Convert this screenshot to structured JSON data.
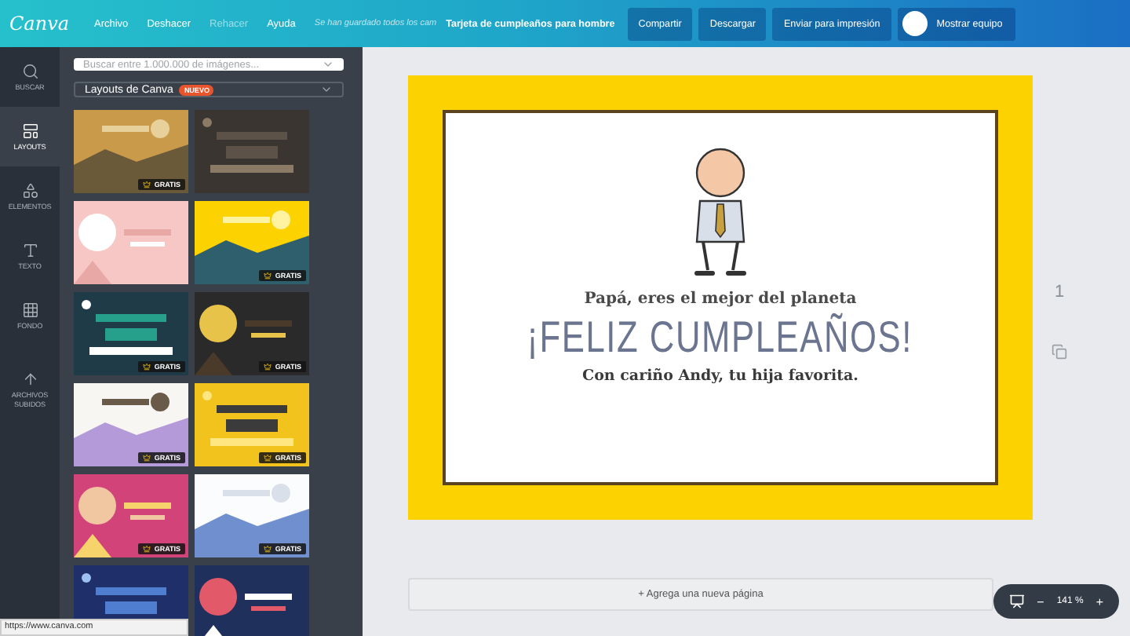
{
  "topbar": {
    "logo": "Canva",
    "menu": [
      {
        "label": "Archivo",
        "disabled": false
      },
      {
        "label": "Deshacer",
        "disabled": false
      },
      {
        "label": "Rehacer",
        "disabled": true
      },
      {
        "label": "Ayuda",
        "disabled": false
      }
    ],
    "save_status": "Se han guardado todos los cam",
    "title": "Tarjeta de cumpleaños para hombre",
    "buttons": [
      "Compartir",
      "Descargar",
      "Enviar para impresión"
    ],
    "team_button": "Mostrar equipo"
  },
  "rail": [
    {
      "kind": "search",
      "label": "BUSCAR",
      "selected": false
    },
    {
      "kind": "layouts",
      "label": "LAYOUTS",
      "selected": true
    },
    {
      "kind": "elements",
      "label": "ELEMENTOS",
      "selected": false
    },
    {
      "kind": "text",
      "label": "TEXTO",
      "selected": false
    },
    {
      "kind": "background",
      "label": "FONDO",
      "selected": false
    },
    {
      "kind": "uploads",
      "label": "ARCHIVOS SUBIDOS",
      "selected": false
    }
  ],
  "panel": {
    "search": {
      "placeholder": "Buscar entre 1.000.000 de imágenes..."
    },
    "layouts_select": {
      "value": "Layouts de Canva",
      "badge": "NUEVO"
    },
    "thumbnails": [
      {
        "kind": "picture",
        "badge": "GRATIS"
      },
      {
        "kind": "picture"
      },
      {
        "kind": "picture"
      },
      {
        "kind": "picture",
        "badge": "GRATIS"
      },
      {
        "kind": "picture",
        "badge": "GRATIS"
      },
      {
        "kind": "picture",
        "badge": "GRATIS"
      },
      {
        "kind": "picture",
        "badge": "GRATIS"
      },
      {
        "kind": "picture",
        "badge": "GRATIS"
      },
      {
        "kind": "picture",
        "badge": "GRATIS"
      },
      {
        "kind": "picture",
        "badge": "GRATIS"
      },
      {
        "kind": "picture"
      },
      {
        "kind": "picture"
      }
    ]
  },
  "design": {
    "subtitle": "Papá, eres el mejor del planeta",
    "headline": "¡FELIZ CUMPLEAÑOS!",
    "signature": "Con cariño Andy, tu hija favorita."
  },
  "page_tools": {
    "page_number": "1"
  },
  "add_page": "+ Agrega una nueva página",
  "zoom": {
    "minus": "−",
    "value": "141 %",
    "plus": "+"
  },
  "status_url": "https://www.canva.com"
}
